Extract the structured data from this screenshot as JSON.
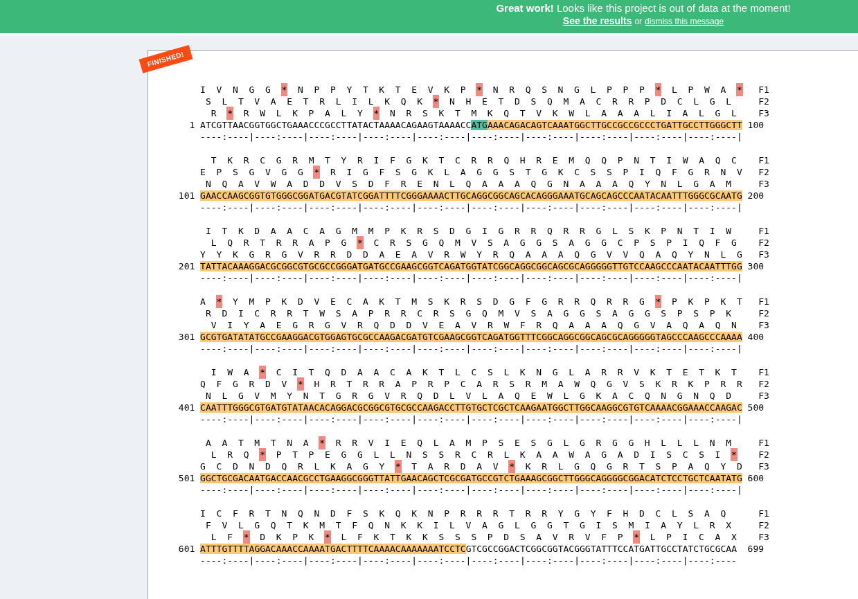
{
  "banner": {
    "headline": "**Great work!** Looks like this project is out of data at the moment!",
    "results_link": "See the results",
    "separator": "or",
    "dismiss_link": "dismiss this message"
  },
  "badge": "FINISHED!",
  "blocks": [
    {
      "start": "1",
      "end": "100",
      "frames": [
        {
          "label": "F1",
          "segments": [
            {
              "text": "IVNGG",
              "stop": false
            },
            {
              "text": "*",
              "stop": true
            },
            {
              "text": "NPPYTKTEVKP",
              "stop": false
            },
            {
              "text": "*",
              "stop": true
            },
            {
              "text": "NRQSNGLPPP",
              "stop": false
            },
            {
              "text": "*",
              "stop": true
            },
            {
              "text": "LPWA",
              "stop": false
            },
            {
              "text": "*",
              "stop": true
            }
          ]
        },
        {
          "label": "F2",
          "segments": [
            {
              "text": "SLTVAETRLILKQK",
              "stop": false
            },
            {
              "text": "*",
              "stop": true
            },
            {
              "text": "NHETDSQMACRRPDCLGL",
              "stop": false
            }
          ]
        },
        {
          "label": "F3",
          "segments": [
            {
              "text": "R",
              "stop": false
            },
            {
              "text": "*",
              "stop": true
            },
            {
              "text": "RWLKPALY",
              "stop": false
            },
            {
              "text": "*",
              "stop": true
            },
            {
              "text": "NRSKTMKQTVKWLAAALIALGL",
              "stop": false
            }
          ]
        }
      ],
      "dna": [
        {
          "text": "ATCGTTAACGGTGGCTGAAACCCGCCTTATACTAAAACAGAAGTAAAACC",
          "kind": "plain"
        },
        {
          "text": "ATG",
          "kind": "start"
        },
        {
          "text": "AAACAGACAGTCAAATGGCTTGCCGCCGCCCTGATTGCCTTGGGCTT",
          "kind": "orf"
        }
      ],
      "ruler": "----:----|----:----|----:----|----:----|----:----|----:----|----:----|----:----|----:----|----:----|"
    },
    {
      "start": "101",
      "end": "200",
      "frames": [
        {
          "label": "F1",
          "segments": [
            {
              "text": "TKRCGRMTYRIFGKTCRRQHREMQQPNTIWAQC",
              "stop": false
            }
          ]
        },
        {
          "label": "F2",
          "segments": [
            {
              "text": "EPSGVGG",
              "stop": false
            },
            {
              "text": "*",
              "stop": true
            },
            {
              "text": "RIGFSGKLAGGSTGKCSSPIQFGRNV",
              "stop": false
            }
          ]
        },
        {
          "label": "F3",
          "segments": [
            {
              "text": "NQAVWADDVSDFRENLQAAAQGNAAAQYNLGAM",
              "stop": false
            }
          ]
        }
      ],
      "dna": [
        {
          "text": "GAACCAAGCGGTGTGGGCGGATGACGTATCGGATTTTCGGGAAAACTTGCAGGCGGCAGCACAGGGAAATGCAGCAGCCCAATACAATTTGGGCGCAATG",
          "kind": "orf"
        }
      ],
      "ruler": "----:----|----:----|----:----|----:----|----:----|----:----|----:----|----:----|----:----|----:----|"
    },
    {
      "start": "201",
      "end": "300",
      "frames": [
        {
          "label": "F1",
          "segments": [
            {
              "text": "ITKDAACAGMMPKRSDGIGRRQRRGLSKPNTIW",
              "stop": false
            }
          ]
        },
        {
          "label": "F2",
          "segments": [
            {
              "text": "LQRTRRAPG",
              "stop": false
            },
            {
              "text": "*",
              "stop": true
            },
            {
              "text": "CRSGQMVSAGGSAGGCPSPIQFG",
              "stop": false
            }
          ]
        },
        {
          "label": "F3",
          "segments": [
            {
              "text": "YYKGRGVRRDDAEAVRWYRQAAAQGVVQAQYNLG",
              "stop": false
            }
          ]
        }
      ],
      "dna": [
        {
          "text": "TATTACAAAGGACGCGGCGTGCGCCGGGATGATGCCGAAGCGGTCAGATGGTATCGGCAGGCGGCAGCGCAGGGGGTTGTCCAAGCCCAATACAATTTGG",
          "kind": "orf"
        }
      ],
      "ruler": "----:----|----:----|----:----|----:----|----:----|----:----|----:----|----:----|----:----|----:----|"
    },
    {
      "start": "301",
      "end": "400",
      "frames": [
        {
          "label": "F1",
          "segments": [
            {
              "text": "A",
              "stop": false
            },
            {
              "text": "*",
              "stop": true
            },
            {
              "text": "YMPKDVECAKTMSKRSDGFGRRQRRG",
              "stop": false
            },
            {
              "text": "*",
              "stop": true
            },
            {
              "text": "PKPKT",
              "stop": false
            }
          ]
        },
        {
          "label": "F2",
          "segments": [
            {
              "text": "RDICRRTWSAPRRCRSGQMVSAGGSAGGSPSPK",
              "stop": false
            }
          ]
        },
        {
          "label": "F3",
          "segments": [
            {
              "text": "VIYAEGRGVRQDDVEAVRWFRQAAAQGVAQAQN",
              "stop": false
            }
          ]
        }
      ],
      "dna": [
        {
          "text": "GCGTGATATATGCCGAAGGACGTGGAGTGCGCCAAGACGATGTCGAAGCGGTCAGATGGTTTCGGCAGGCGGCAGCGCAGGGGGTAGCCCAAGCCCAAAA",
          "kind": "orf"
        }
      ],
      "ruler": "----:----|----:----|----:----|----:----|----:----|----:----|----:----|----:----|----:----|----:----|"
    },
    {
      "start": "401",
      "end": "500",
      "frames": [
        {
          "label": "F1",
          "segments": [
            {
              "text": "IWA",
              "stop": false
            },
            {
              "text": "*",
              "stop": true
            },
            {
              "text": "CITQDAACAKTLCSLKNGLARRVKTETKT",
              "stop": false
            }
          ]
        },
        {
          "label": "F2",
          "segments": [
            {
              "text": "QFGRDV",
              "stop": false
            },
            {
              "text": "*",
              "stop": true
            },
            {
              "text": "HRTRRAPRPCARSRMAWQGVSKRKPRR",
              "stop": false
            }
          ]
        },
        {
          "label": "F3",
          "segments": [
            {
              "text": "NLGVMYNTGRGVRQDLVLAQEWLGKACQNGNQD",
              "stop": false
            }
          ]
        }
      ],
      "dna": [
        {
          "text": "CAATTTGGGCGTGATGTATAACACAGGACGCGGCGTGCGCCAAGACCTTGTGCTCGCTCAAGAATGGCTTGGCAAGGCGTGTCAAAACGGAAACCAAGAC",
          "kind": "orf"
        }
      ],
      "ruler": "----:----|----:----|----:----|----:----|----:----|----:----|----:----|----:----|----:----|----:----|"
    },
    {
      "start": "501",
      "end": "600",
      "frames": [
        {
          "label": "F1",
          "segments": [
            {
              "text": "AATMTNA",
              "stop": false
            },
            {
              "text": "*",
              "stop": true
            },
            {
              "text": "RRVIEQLAMPSESGLGRGGHLLLNM",
              "stop": false
            }
          ]
        },
        {
          "label": "F2",
          "segments": [
            {
              "text": "LRQ",
              "stop": false
            },
            {
              "text": "*",
              "stop": true
            },
            {
              "text": "PTPEGGLLNSSRCRLKAAWAGADISCSI",
              "stop": false
            },
            {
              "text": "*",
              "stop": true
            }
          ]
        },
        {
          "label": "F3",
          "segments": [
            {
              "text": "GCDNDQRLKAGY",
              "stop": false
            },
            {
              "text": "*",
              "stop": true
            },
            {
              "text": "TARDAV",
              "stop": false
            },
            {
              "text": "*",
              "stop": true
            },
            {
              "text": "KRLGQGRTSPAQYD",
              "stop": false
            }
          ]
        }
      ],
      "dna": [
        {
          "text": "GGCTGCGACAATGACCAACGCCTGAAGGCGGGTTATTGAACAGCTCGCGATGCCGTCTGAAAGCGGCTTGGGCAGGGGCGGACATCTCCTGCTCAATATG",
          "kind": "orf"
        }
      ],
      "ruler": "----:----|----:----|----:----|----:----|----:----|----:----|----:----|----:----|----:----|----:----|"
    },
    {
      "start": "601",
      "end": "699",
      "frames": [
        {
          "label": "F1",
          "segments": [
            {
              "text": "ICFRTNQNDFSKQKNPRRRTRRYGYFHDCLSAQ",
              "stop": false
            }
          ]
        },
        {
          "label": "F2",
          "segments": [
            {
              "text": "FVLGQTKMTFQNKKILVAGLGGTGISMIAYLRX",
              "stop": false
            }
          ]
        },
        {
          "label": "F3",
          "segments": [
            {
              "text": "LF",
              "stop": false
            },
            {
              "text": "*",
              "stop": true
            },
            {
              "text": "DKPK",
              "stop": false
            },
            {
              "text": "*",
              "stop": true
            },
            {
              "text": "LFKTKKSSSPDSAVRVFP",
              "stop": false
            },
            {
              "text": "*",
              "stop": true
            },
            {
              "text": "LPICAX",
              "stop": false
            }
          ]
        }
      ],
      "dna": [
        {
          "text": "ATTTGTTTTAGGACAAACCAAAATGACTTTTCAAAACAAAAAAATCCTC",
          "kind": "orf"
        },
        {
          "text": "GTCGCCGGACTCGGCGGTACGGGTATTTCCATGATTGCCTATCTGCGCAA",
          "kind": "plain"
        }
      ],
      "ruler": "----:----|----:----|----:----|----:----|----:----|----:----|----:----|----:----|----:----|----:----"
    }
  ]
}
